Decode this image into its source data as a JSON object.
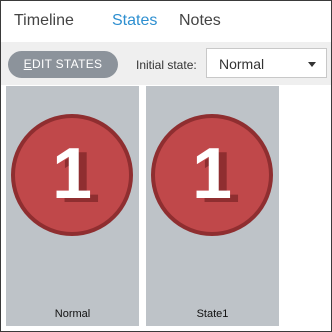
{
  "tabs": [
    {
      "label": "Timeline",
      "active": false
    },
    {
      "label": "States",
      "active": true
    },
    {
      "label": "Notes",
      "active": false
    }
  ],
  "toolbar": {
    "edit_states_first": "E",
    "edit_states_rest": "DIT STATES",
    "initial_state_label": "Initial state:",
    "initial_state_value": "Normal"
  },
  "states": [
    {
      "name": "Normal",
      "badge": "1"
    },
    {
      "name": "State1",
      "badge": "1"
    }
  ],
  "colors": {
    "accent_tab": "#2e8fd0",
    "badge_fill": "#c0484a",
    "badge_ring": "#8f2e30",
    "card_bg": "#bec3c8",
    "button_bg": "#8c939b"
  }
}
